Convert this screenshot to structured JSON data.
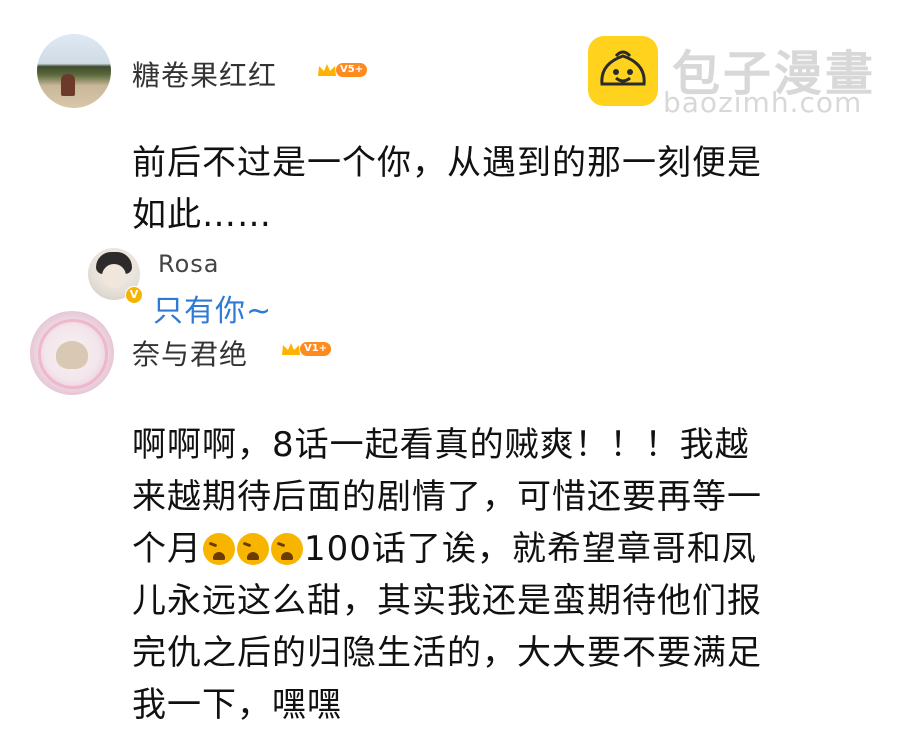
{
  "watermark": {
    "title": "包子漫畫",
    "url": "baozimh.com",
    "icon": "bun-smiley-icon"
  },
  "comments": [
    {
      "username": "糖卷果红红",
      "vip_level": "V5+",
      "text_line1": "前后不过是一个你，从遇到的那一刻便是",
      "text_line2": "如此……",
      "reply": {
        "username": "Rosa",
        "verified_badge": "V",
        "text": "只有你~"
      }
    },
    {
      "username": "奈与君绝",
      "vip_level": "V1+",
      "lines": [
        "啊啊啊，8话一起看真的贼爽！！！我越",
        "来越期待后面的剧情了，可惜还要再等一",
        "100话了诶，就希望章哥和凤",
        "儿永远这么甜，其实我还是蛮期待他们报",
        "完仇之后的归隐生活的，大大要不要满足",
        "我一下，嘿嘿"
      ],
      "line3_prefix": "个月",
      "line3_emojis": [
        "crying-face-emoji",
        "crying-face-emoji",
        "crying-face-emoji"
      ]
    }
  ],
  "colors": {
    "reply_link": "#2d7bd6",
    "vip_tag": "#ff8a1e",
    "watermark_yellow": "#ffd21e"
  }
}
